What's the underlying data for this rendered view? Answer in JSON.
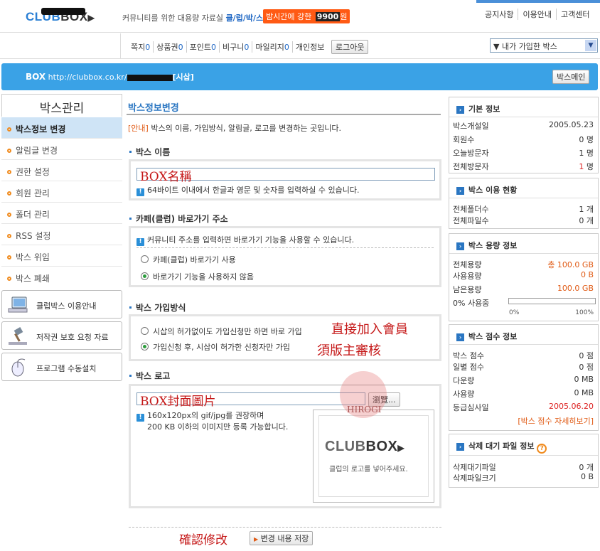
{
  "header": {
    "logo": {
      "part1": "CLUB",
      "part2": "BOX"
    },
    "tagline": "커뮤니티를 위한 대용량 자료실",
    "tagline_brand": "클/럽/박/스",
    "promo_text": "밤시간에 강한",
    "promo_number": "9900",
    "promo_suffix": "원",
    "links": [
      "공지사항",
      "이용안내",
      "고객센터"
    ]
  },
  "userbar": {
    "items": [
      {
        "label": "쪽지",
        "value": "0"
      },
      {
        "label": "상품권",
        "value": "0"
      },
      {
        "label": "포인트",
        "value": "0"
      },
      {
        "label": "비구니",
        "value": "0"
      },
      {
        "label": "마일리지",
        "value": "0"
      },
      {
        "label": "개인정보",
        "value": ""
      }
    ],
    "logout_label": "로그아웃",
    "box_select": "▼ 내가 가입한 박스"
  },
  "boxbar": {
    "label": "BOX",
    "url": "http://clubbox.co.kr/",
    "suffix": "[시삽]",
    "main_button": "박스메인"
  },
  "leftnav": {
    "title": "박스관리",
    "items": [
      "박스정보 변경",
      "알림글 변경",
      "권한 설정",
      "회원 관리",
      "폴더 관리",
      "RSS 설정",
      "박스 위임",
      "박스 폐쇄"
    ],
    "cards": [
      "클럽박스 이용안내",
      "저작권 보호 요청 자료",
      "프로그램 수동설치"
    ]
  },
  "main": {
    "title": "박스정보변경",
    "notice_tag": "[안내]",
    "notice": " 박스의 이름, 가입방식, 알림글, 로고를 변경하는 곳입니다.",
    "name_section": {
      "title": "박스 이름",
      "input_value": "BOX名稱",
      "hint": "64바이트 이내에서 한글과 영문 및 숫자를 입력하실 수 있습니다."
    },
    "shortcut_section": {
      "title": "카페(클럽) 바로가기 주소",
      "hint": "커뮤니티 주소를 입력하면 바로가기 기능을 사용할 수 있습니다.",
      "options": [
        "카페(클럽) 바로가기 사용",
        "바로가기 기능을 사용하지 않음"
      ]
    },
    "join_section": {
      "title": "박스 가입방식",
      "options": [
        "시삽의 허가없이도 가입신청만 하면 바로 가입",
        "가입신청 후, 시삽이 허가한 신청자만 가입"
      ],
      "annotations": [
        "直接加入會員",
        "須版主審核"
      ]
    },
    "logo_section": {
      "title": "박스 로고",
      "input_value": "BOX封面圖片",
      "browse_label": "瀏覽...",
      "hint_line1": "160x120px의 gif/jpg를 권장하며",
      "hint_line2": "200 KB 이하의 이미지만 등록 가능합니다.",
      "preview_logo_part1": "CLUB",
      "preview_logo_part2": "BOX",
      "preview_caption": "클럽의 로고를 넣어주세요.",
      "watermark": "HIROGI"
    },
    "confirm_annotation": "確認修改",
    "save_label": "변경 내용 저장"
  },
  "sidebar": {
    "basic": {
      "title": "기본 정보",
      "rows": [
        {
          "label": "박스개설일",
          "value": "2005.05.23"
        },
        {
          "label": "회원수",
          "value": "0 명"
        },
        {
          "label": "오늘방문자",
          "value": "1 명"
        },
        {
          "label": "전체방문자",
          "value_num": "1",
          "value_unit": " 명"
        }
      ]
    },
    "usage": {
      "title": "박스 이용 현황",
      "rows": [
        {
          "label": "전체폴더수",
          "value": "1 개"
        },
        {
          "label": "전체파일수",
          "value": "0 개"
        }
      ]
    },
    "capacity": {
      "title": "박스 용량 정보",
      "rows": [
        {
          "label": "전체용량",
          "value": "총 100.0 GB"
        },
        {
          "label": "사용용량",
          "value": "0 B"
        },
        {
          "label": "남은용량",
          "value": "100.0 GB"
        }
      ],
      "usage_label": "0% 사용중",
      "usage_fraction": 0,
      "pct_min": "0%",
      "pct_max": "100%"
    },
    "score": {
      "title": "박스 점수 정보",
      "rows": [
        {
          "label": "박스 점수",
          "value": "0 점"
        },
        {
          "label": "일별 점수",
          "value": "0 점"
        },
        {
          "label": "다운량",
          "value": "0 MB"
        },
        {
          "label": "사용량",
          "value": "0 MB"
        },
        {
          "label": "등급심사일",
          "value": "2005.06.20"
        }
      ],
      "more_link": "[박스 점수 자세히보기]"
    },
    "pending": {
      "title": "삭제 대기 파일 정보",
      "rows": [
        {
          "label": "삭제대기파일",
          "value": "0 개"
        },
        {
          "label": "삭제파일크기",
          "value": "0 B"
        }
      ]
    }
  },
  "colors": {
    "accent_blue": "#3aa2e6",
    "brand_blue": "#2a7fd4",
    "promo": "#ff5a14",
    "handwriting": "#c51818"
  }
}
